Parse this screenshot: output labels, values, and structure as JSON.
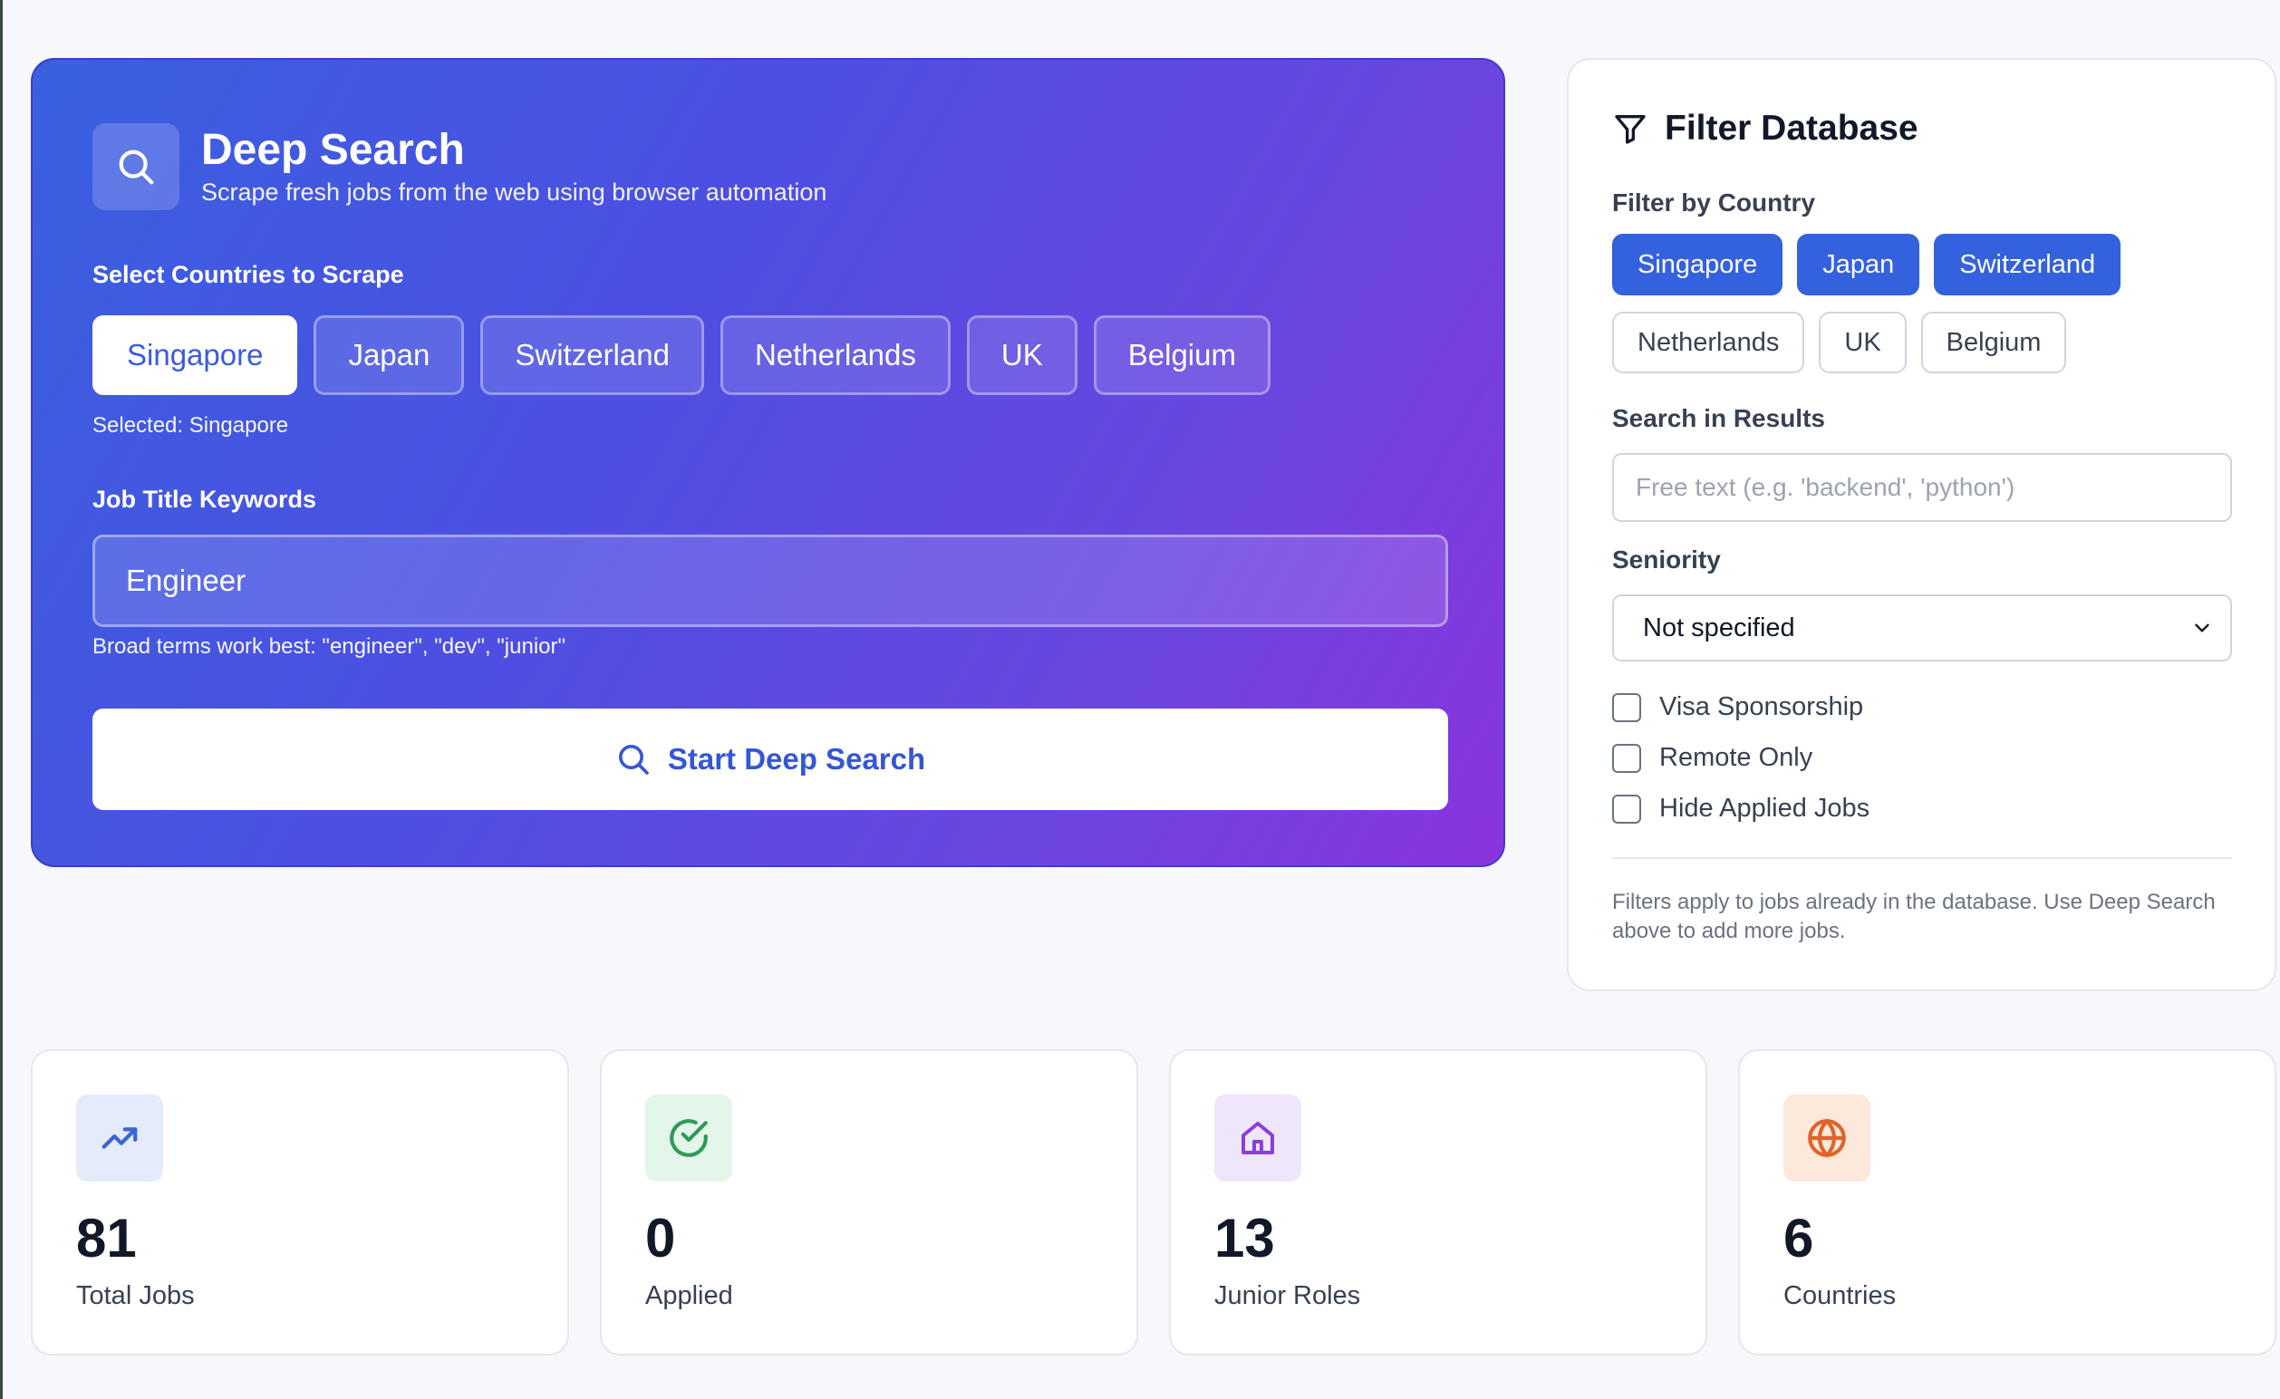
{
  "deep_search": {
    "title": "Deep Search",
    "subtitle": "Scrape fresh jobs from the web using browser automation",
    "countries_label": "Select Countries to Scrape",
    "countries": [
      "Singapore",
      "Japan",
      "Switzerland",
      "Netherlands",
      "UK",
      "Belgium"
    ],
    "selected_countries": [
      "Singapore"
    ],
    "selected_text": "Selected: Singapore",
    "keywords_label": "Job Title Keywords",
    "keywords_value": "Engineer",
    "keywords_hint": "Broad terms work best: \"engineer\", \"dev\", \"junior\"",
    "start_button": "Start Deep Search"
  },
  "filter": {
    "title": "Filter Database",
    "country_label": "Filter by Country",
    "countries": [
      "Singapore",
      "Japan",
      "Switzerland",
      "Netherlands",
      "UK",
      "Belgium"
    ],
    "active_countries": [
      "Singapore",
      "Japan",
      "Switzerland"
    ],
    "search_label": "Search in Results",
    "search_placeholder": "Free text (e.g. 'backend', 'python')",
    "seniority_label": "Seniority",
    "seniority_value": "Not specified",
    "checkboxes": [
      {
        "label": "Visa Sponsorship",
        "checked": false
      },
      {
        "label": "Remote Only",
        "checked": false
      },
      {
        "label": "Hide Applied Jobs",
        "checked": false
      }
    ],
    "note": "Filters apply to jobs already in the database. Use Deep Search above to add more jobs."
  },
  "stats": [
    {
      "value": "81",
      "label": "Total Jobs",
      "icon": "trending-up-icon",
      "color": "#3b63d8",
      "bg": "#e4ebfb"
    },
    {
      "value": "0",
      "label": "Applied",
      "icon": "check-circle-icon",
      "color": "#2f9a58",
      "bg": "#e3f6e9"
    },
    {
      "value": "13",
      "label": "Junior Roles",
      "icon": "home-icon",
      "color": "#8a3fd6",
      "bg": "#f0e6fb"
    },
    {
      "value": "6",
      "label": "Countries",
      "icon": "globe-icon",
      "color": "#e0642a",
      "bg": "#fde9dc"
    }
  ],
  "colors": {
    "accent": "#3461de",
    "gradient_start": "#3960e0",
    "gradient_end": "#8a34dd"
  }
}
